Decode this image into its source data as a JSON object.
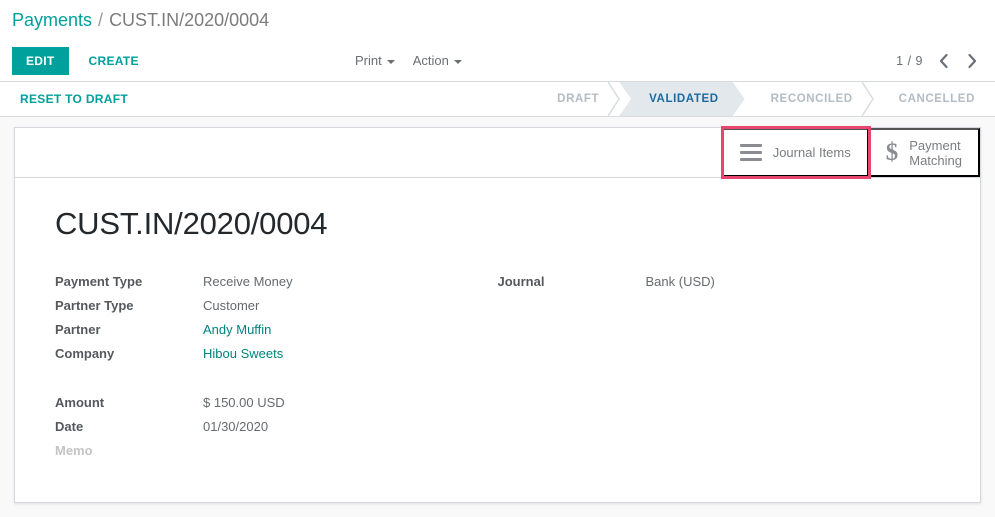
{
  "breadcrumb": {
    "parent": "Payments",
    "separator": "/",
    "current": "CUST.IN/2020/0004"
  },
  "control_panel": {
    "edit_label": "EDIT",
    "create_label": "CREATE",
    "print_label": "Print",
    "action_label": "Action",
    "pager": {
      "text": "1 / 9",
      "prev_icon": "chevron-left-icon",
      "next_icon": "chevron-right-icon"
    }
  },
  "statusbar": {
    "reset_label": "RESET TO DRAFT",
    "stages": [
      {
        "label": "DRAFT",
        "active": false
      },
      {
        "label": "VALIDATED",
        "active": true
      },
      {
        "label": "RECONCILED",
        "active": false
      },
      {
        "label": "CANCELLED",
        "active": false
      }
    ]
  },
  "smart_buttons": [
    {
      "label": "Journal Items",
      "icon": "hamburger-icon",
      "highlighted": true
    },
    {
      "label": "Payment\nMatching",
      "icon": "dollar-icon",
      "highlighted": false
    }
  ],
  "record": {
    "title": "CUST.IN/2020/0004",
    "left_group_1": [
      {
        "label": "Payment Type",
        "value": "Receive Money",
        "is_link": false
      },
      {
        "label": "Partner Type",
        "value": "Customer",
        "is_link": false
      },
      {
        "label": "Partner",
        "value": "Andy Muffin",
        "is_link": true
      },
      {
        "label": "Company",
        "value": "Hibou Sweets",
        "is_link": true
      }
    ],
    "left_group_2": [
      {
        "label": "Amount",
        "value": "$ 150.00  USD",
        "is_link": false
      },
      {
        "label": "Date",
        "value": "01/30/2020",
        "is_link": false
      },
      {
        "label": "Memo",
        "value": "",
        "is_link": false,
        "empty": true
      }
    ],
    "right_group": [
      {
        "label": "Journal",
        "value": "Bank (USD)",
        "is_link": false
      }
    ]
  },
  "colors": {
    "accent_teal": "#00a09d",
    "link_teal": "#00847e",
    "highlight_pink": "#e8466e",
    "stage_active_bg": "#e3e8ed",
    "stage_active_text": "#1a6aa2"
  }
}
